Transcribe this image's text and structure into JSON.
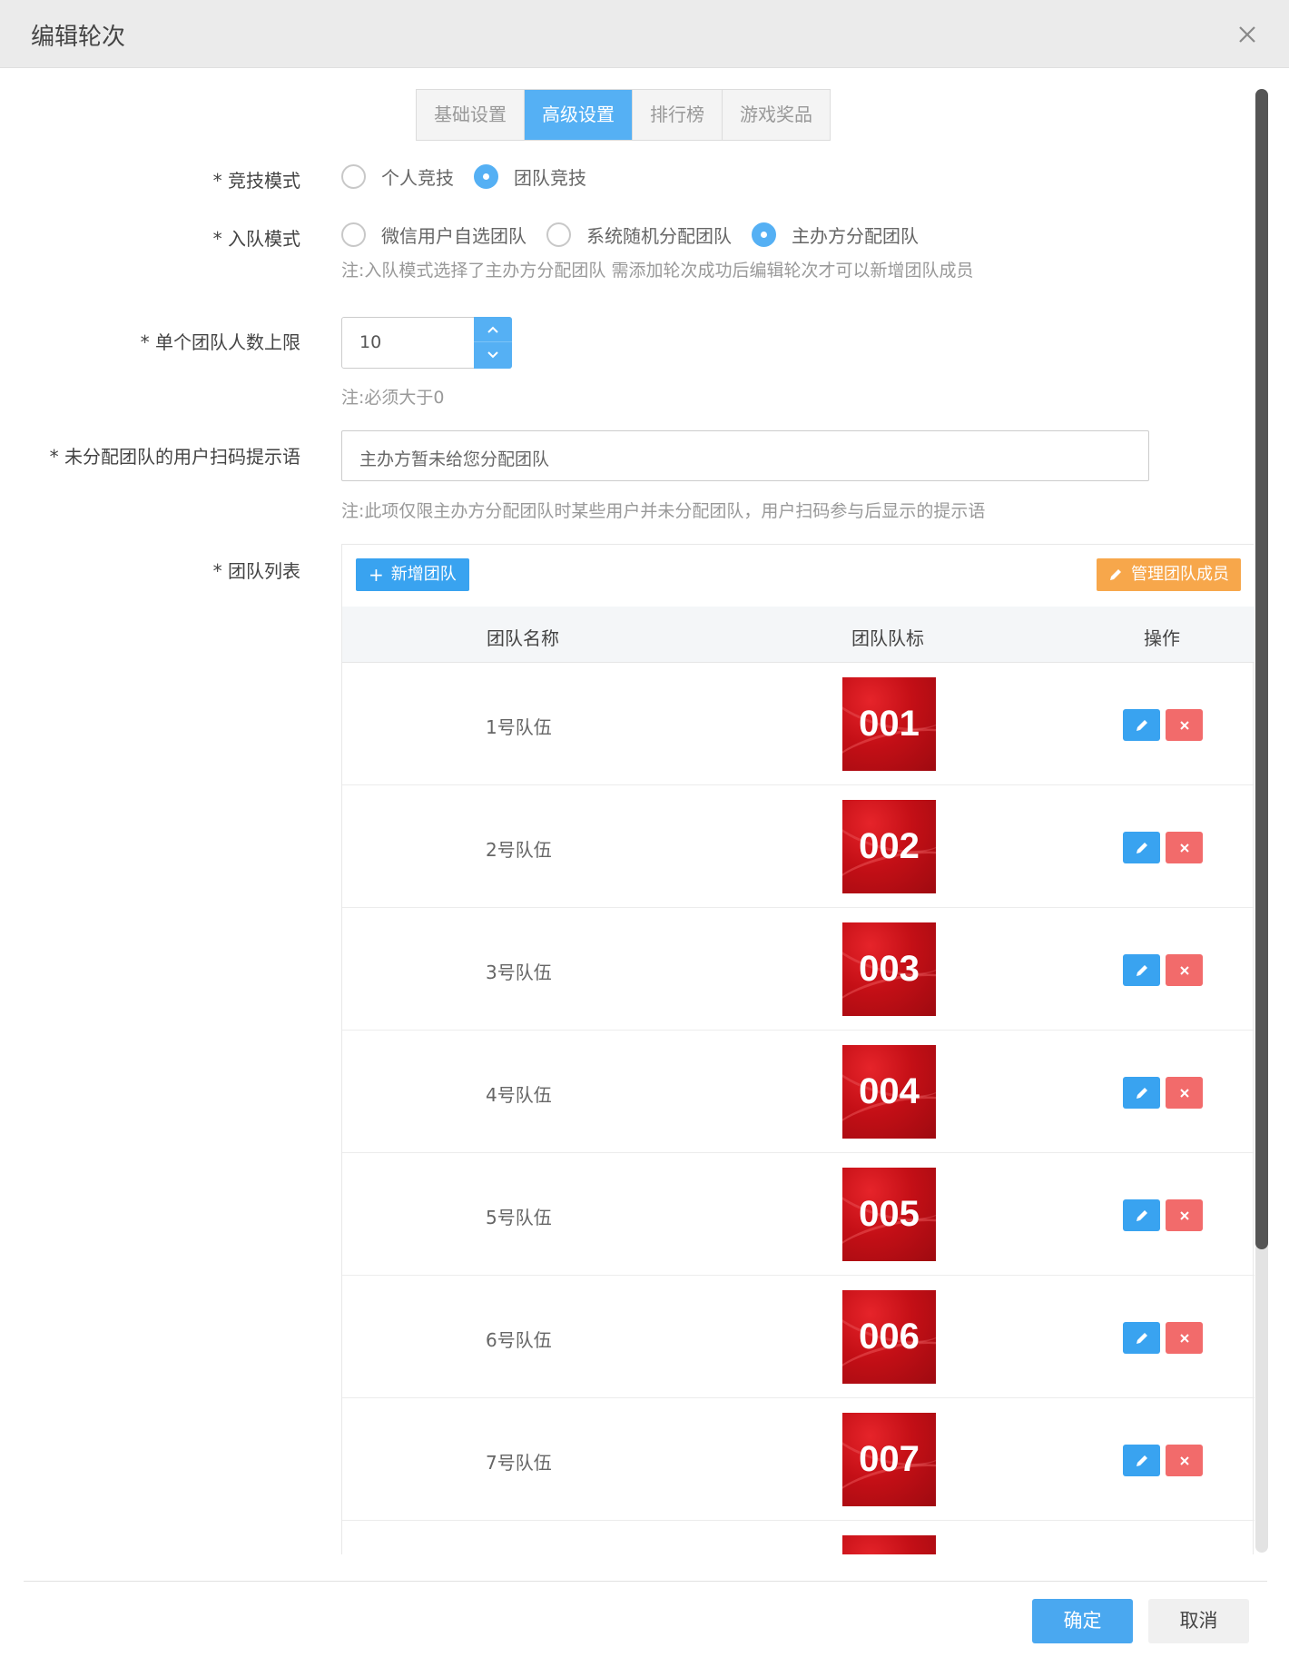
{
  "modal": {
    "title": "编辑轮次",
    "close_icon": "close-icon"
  },
  "tabs": [
    {
      "label": "基础设置",
      "active": false
    },
    {
      "label": "高级设置",
      "active": true
    },
    {
      "label": "排行榜",
      "active": false
    },
    {
      "label": "游戏奖品",
      "active": false
    }
  ],
  "form": {
    "competition_mode": {
      "label": "* 竞技模式",
      "options": [
        {
          "label": "个人竞技",
          "checked": false
        },
        {
          "label": "团队竞技",
          "checked": true
        }
      ]
    },
    "join_mode": {
      "label": "* 入队模式",
      "options": [
        {
          "label": "微信用户自选团队",
          "checked": false
        },
        {
          "label": "系统随机分配团队",
          "checked": false
        },
        {
          "label": "主办方分配团队",
          "checked": true
        }
      ],
      "note": "注:入队模式选择了主办方分配团队 需添加轮次成功后编辑轮次才可以新增团队成员"
    },
    "team_limit": {
      "label": "* 单个团队人数上限",
      "value": "10",
      "note": "注:必须大于0"
    },
    "unassigned_tip": {
      "label": "* 未分配团队的用户扫码提示语",
      "value": "主办方暂未给您分配团队",
      "note": "注:此项仅限主办方分配团队时某些用户并未分配团队，用户扫码参与后显示的提示语"
    },
    "team_list": {
      "label": "* 团队列表",
      "add_button": "新增团队",
      "manage_button": "管理团队成员",
      "columns": [
        "团队名称",
        "团队队标",
        "操作"
      ],
      "rows": [
        {
          "name": "1号队伍",
          "logo": "001"
        },
        {
          "name": "2号队伍",
          "logo": "002"
        },
        {
          "name": "3号队伍",
          "logo": "003"
        },
        {
          "name": "4号队伍",
          "logo": "004"
        },
        {
          "name": "5号队伍",
          "logo": "005"
        },
        {
          "name": "6号队伍",
          "logo": "006"
        },
        {
          "name": "7号队伍",
          "logo": "007"
        },
        {
          "name": "",
          "logo": ""
        }
      ]
    }
  },
  "footer": {
    "ok": "确定",
    "cancel": "取消"
  },
  "colors": {
    "accent": "#55b0f4",
    "edit": "#39a3f0",
    "delete": "#f26b6b",
    "manage": "#f7a74b",
    "logo_red": "#c40f16"
  }
}
